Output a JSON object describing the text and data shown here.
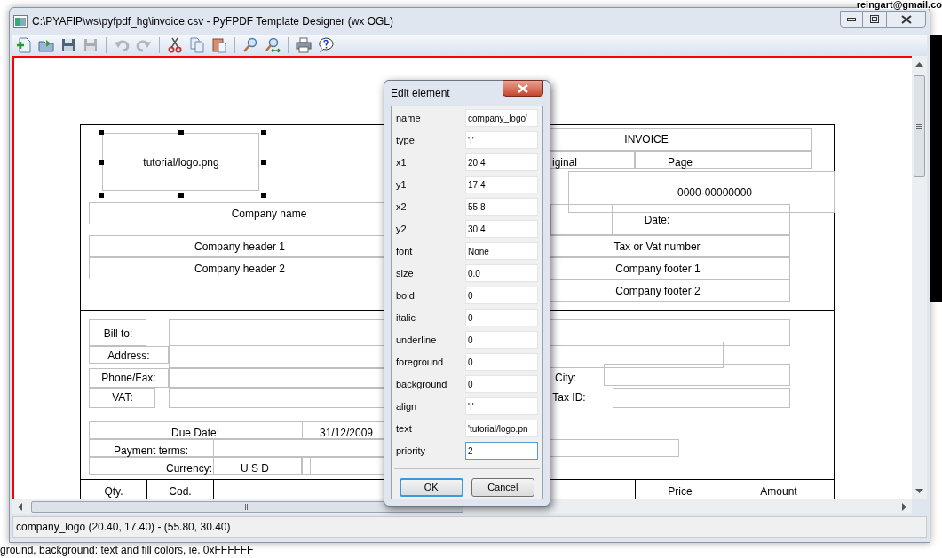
{
  "desktop": {
    "email": "reingart@gmail.co",
    "footer_text": "ground, background: text and fill colors, ie. 0xFFFFFF"
  },
  "window": {
    "title": "C:\\PYAFIP\\ws\\pyfpdf_hg\\invoice.csv - PyFPDF Template Designer (wx OGL)"
  },
  "toolbar": [
    {
      "kind": "new",
      "disabled": false
    },
    {
      "kind": "open",
      "disabled": false
    },
    {
      "kind": "save",
      "disabled": false
    },
    {
      "kind": "save",
      "disabled": true
    },
    {
      "kind": "sep"
    },
    {
      "kind": "undo",
      "disabled": true
    },
    {
      "kind": "redo",
      "disabled": true
    },
    {
      "kind": "sep"
    },
    {
      "kind": "cut",
      "disabled": false
    },
    {
      "kind": "copy",
      "disabled": false
    },
    {
      "kind": "paste",
      "disabled": false
    },
    {
      "kind": "sep"
    },
    {
      "kind": "zoom",
      "disabled": false
    },
    {
      "kind": "zoomfit",
      "disabled": false
    },
    {
      "kind": "sep"
    },
    {
      "kind": "print",
      "disabled": false
    },
    {
      "kind": "help",
      "disabled": false
    }
  ],
  "canvas": {
    "elements": [
      {
        "text": "tutorial/logo.png",
        "selected": true
      },
      {
        "text": "Company name",
        "selected": false
      },
      {
        "text": "Company header 1",
        "selected": false
      },
      {
        "text": "Company header 2",
        "selected": false
      },
      {
        "text": "INVOICE",
        "selected": false
      },
      {
        "text": "iginal",
        "selected": false
      },
      {
        "text": "Page",
        "selected": false
      },
      {
        "text": "0000-00000000",
        "selected": false
      },
      {
        "text": "Date:",
        "selected": false
      },
      {
        "text": "Tax or Vat number",
        "selected": false
      },
      {
        "text": "Company footer 1",
        "selected": false
      },
      {
        "text": "Company footer 2",
        "selected": false
      },
      {
        "text": "Bill to:",
        "selected": false
      },
      {
        "text": "Address:",
        "selected": false
      },
      {
        "text": "Phone/Fax:",
        "selected": false
      },
      {
        "text": "VAT:",
        "selected": false
      },
      {
        "text": "City:",
        "selected": false
      },
      {
        "text": "Tax ID:",
        "selected": false
      },
      {
        "text": "Due Date:",
        "selected": false
      },
      {
        "text": "31/12/2009",
        "selected": false
      },
      {
        "text": "Payment terms:",
        "selected": false
      },
      {
        "text": "Currency:",
        "selected": false
      },
      {
        "text": "U S D",
        "selected": false
      },
      {
        "text": "Qty.",
        "selected": false
      },
      {
        "text": "Cod.",
        "selected": false
      },
      {
        "text": "Price",
        "selected": false
      },
      {
        "text": "Amount",
        "selected": false
      }
    ]
  },
  "dialog": {
    "title": "Edit element",
    "fields": [
      {
        "label": "name",
        "value": "company_logo'",
        "focused": false
      },
      {
        "label": "type",
        "value": "'I'",
        "focused": false
      },
      {
        "label": "x1",
        "value": "20.4",
        "focused": false
      },
      {
        "label": "y1",
        "value": "17.4",
        "focused": false
      },
      {
        "label": "x2",
        "value": "55.8",
        "focused": false
      },
      {
        "label": "y2",
        "value": "30.4",
        "focused": false
      },
      {
        "label": "font",
        "value": "None",
        "focused": false
      },
      {
        "label": "size",
        "value": "0.0",
        "focused": false
      },
      {
        "label": "bold",
        "value": "0",
        "focused": false
      },
      {
        "label": "italic",
        "value": "0",
        "focused": false
      },
      {
        "label": "underline",
        "value": "0",
        "focused": false
      },
      {
        "label": "foreground",
        "value": "0",
        "focused": false
      },
      {
        "label": "background",
        "value": "0",
        "focused": false
      },
      {
        "label": "align",
        "value": "'I'",
        "focused": false
      },
      {
        "label": "text",
        "value": "'tutorial/logo.pn",
        "focused": false
      },
      {
        "label": "priority",
        "value": "2",
        "focused": true
      }
    ],
    "buttons": [
      {
        "label": "OK",
        "default": true
      },
      {
        "label": "Cancel",
        "default": false
      }
    ]
  },
  "status_bar": "company_logo (20.40, 17.40) - (55.80, 30.40)"
}
